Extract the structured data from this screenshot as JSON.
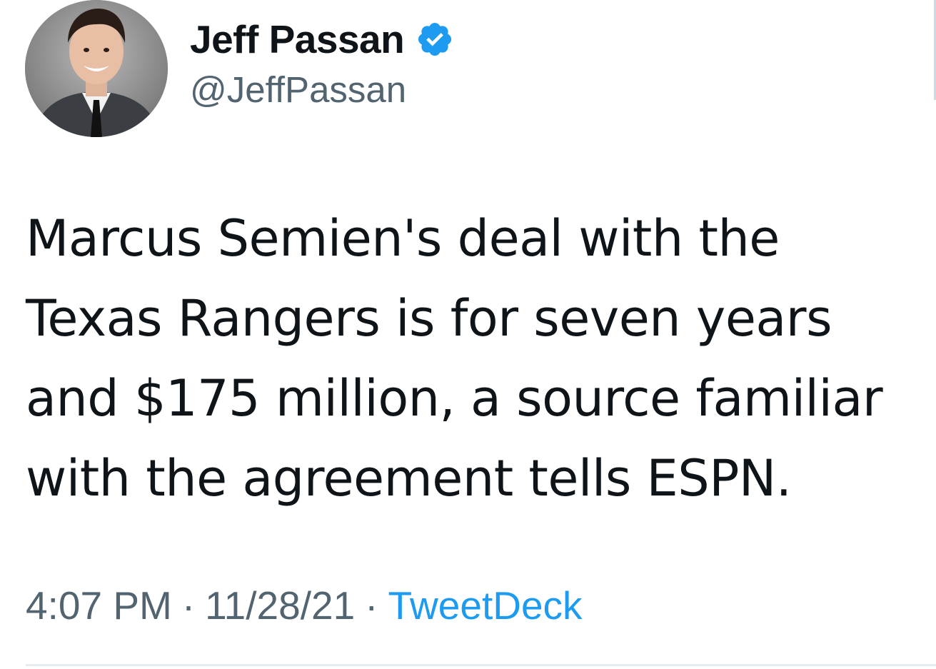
{
  "author": {
    "display_name": "Jeff Passan",
    "handle": "@JeffPassan",
    "verified": true,
    "avatar_icon": "profile-photo",
    "verified_icon": "verified-badge-icon",
    "verified_color": "#1d9bf0"
  },
  "tweet": {
    "text": "Marcus Semien's deal with the Texas Rangers is for seven years and $175 million, a source familiar with the agreement tells ESPN."
  },
  "meta": {
    "time": "4:07 PM",
    "separator": "·",
    "date": "11/28/21",
    "source": "TweetDeck",
    "source_color": "#1d9bf0",
    "meta_color": "#536471"
  }
}
